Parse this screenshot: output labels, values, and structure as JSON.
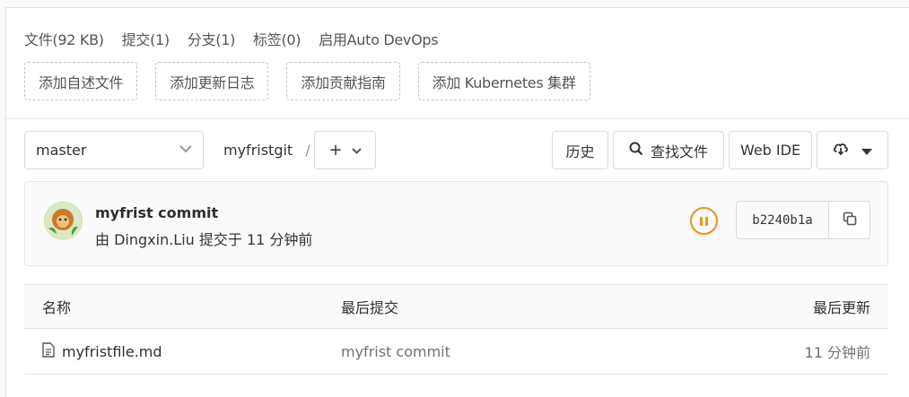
{
  "stats": {
    "files": "文件(92 KB)",
    "commits": "提交(1)",
    "branches": "分支(1)",
    "tags": "标签(0)",
    "autodevops": "启用Auto DevOps"
  },
  "add_buttons": [
    "添加自述文件",
    "添加更新日志",
    "添加贡献指南",
    "添加 Kubernetes 集群"
  ],
  "toolbar": {
    "branch": "master",
    "repo_crumb": "myfristgit",
    "crumb_sep": "/",
    "plus": "+",
    "history": "历史",
    "find_file": "查找文件",
    "web_ide": "Web IDE"
  },
  "commit": {
    "title": "myfrist commit",
    "meta": "由 Dingxin.Liu 提交于 11 分钟前",
    "sha": "b2240b1a",
    "pipeline_color": "#e8951c"
  },
  "table": {
    "headers": {
      "name": "名称",
      "last_commit": "最后提交",
      "last_update": "最后更新"
    },
    "rows": [
      {
        "name": "myfristfile.md",
        "last_commit": "myfrist commit",
        "last_update": "11 分钟前"
      }
    ]
  }
}
